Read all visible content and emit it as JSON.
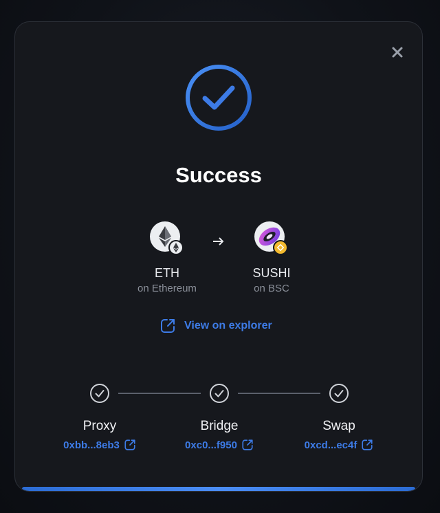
{
  "modal": {
    "title": "Success",
    "close_icon": "close-icon",
    "status_icon": "check-circle-icon",
    "accent_color": "#3d7be6"
  },
  "route": {
    "from": {
      "symbol": "ETH",
      "network": "on Ethereum",
      "icon": "ethereum-icon"
    },
    "to": {
      "symbol": "SUSHI",
      "network": "on BSC",
      "icon": "sushi-icon",
      "badge_icon": "bnb-icon"
    },
    "arrow_icon": "arrow-right-icon"
  },
  "explorer": {
    "label": "View on explorer",
    "icon": "external-link-icon"
  },
  "steps": [
    {
      "label": "Proxy",
      "hash": "0xbb...8eb3",
      "status": "complete"
    },
    {
      "label": "Bridge",
      "hash": "0xc0...f950",
      "status": "complete"
    },
    {
      "label": "Swap",
      "hash": "0xcd...ec4f",
      "status": "complete"
    }
  ],
  "progress": {
    "value": 1.0
  }
}
